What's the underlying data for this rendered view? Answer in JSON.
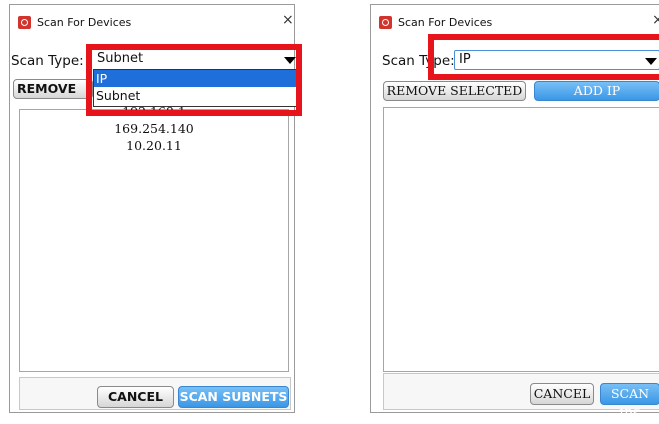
{
  "left_dialog": {
    "title": "Scan For Devices",
    "close": "×",
    "scan_type_label": "Scan Type:",
    "scan_type_value": "Subnet",
    "dropdown_options": [
      "IP",
      "Subnet"
    ],
    "dropdown_highlighted": "IP",
    "remove_button": "REMOVE",
    "subnets": [
      "192.168.1",
      "169.254.140",
      "10.20.11"
    ],
    "cancel_button": "CANCEL",
    "scan_button": "SCAN SUBNETS"
  },
  "right_dialog": {
    "title": "Scan For Devices",
    "close": "×",
    "scan_type_label": "Scan Type:",
    "scan_type_value": "IP",
    "remove_button": "REMOVE SELECTED",
    "add_button": "ADD IP",
    "cancel_button": "CANCEL",
    "scan_button": "SCAN IPS"
  },
  "colors": {
    "highlight": "#e8141b",
    "accent_blue": "#3a97e6",
    "selected_option": "#1e6fd9"
  }
}
